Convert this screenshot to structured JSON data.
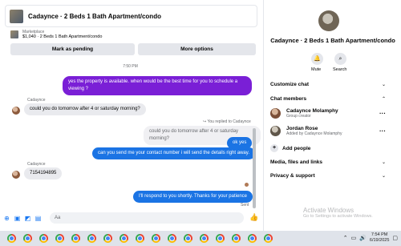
{
  "header": {
    "title": "Cadaynce · 2 Beds 1 Bath Apartment/condo",
    "info_icon": "info-icon"
  },
  "listing": {
    "source": "Marketplace",
    "price_title": "$1,040 · 2 Beds 1 Bath Apartment/condo"
  },
  "actions": {
    "mark_pending": "Mark as pending",
    "more_options": "More options"
  },
  "messages": {
    "timestamp": "7:50 PM",
    "m1": "yes the property is available. when would be the best time for you to schedule a viewing ?",
    "sender1": "Cadaynce",
    "m2": "could you do tomorrow after 4 or saturday morning?",
    "replied_label": "You replied to Cadaynce",
    "quoted": "could you do tomorrow after 4 or saturday morning?",
    "m3": "ok yes",
    "m4": "can you send me your contact number i will send the details right away.",
    "sender2": "Cadaynce",
    "m5": "7154194895",
    "m6": "I'll respond to you shortly. Thanks for your patience",
    "sent_label": "Sent"
  },
  "composer": {
    "placeholder": "Aa"
  },
  "panel": {
    "name": "Cadaynce · 2 Beds 1 Bath Apartment/condo",
    "mute": "Mute",
    "search": "Search",
    "customize": "Customize chat",
    "members_heading": "Chat members",
    "members": [
      {
        "name": "Cadaynce Molamphy",
        "sub": "Group creator"
      },
      {
        "name": "Jordan Rose",
        "sub": "Added by Cadaynce Molamphy"
      }
    ],
    "add_people": "Add people",
    "media": "Media, files and links",
    "privacy": "Privacy & support"
  },
  "watermark": {
    "title": "Activate Windows",
    "subtitle": "Go to Settings to activate Windows."
  },
  "taskbar": {
    "time": "7:54 PM",
    "date": "6/19/2025",
    "app_count": 17
  },
  "colors": {
    "accent_purple": "#7a1fd6",
    "accent_blue": "#1b74e4",
    "messenger_blue": "#1877f2"
  }
}
